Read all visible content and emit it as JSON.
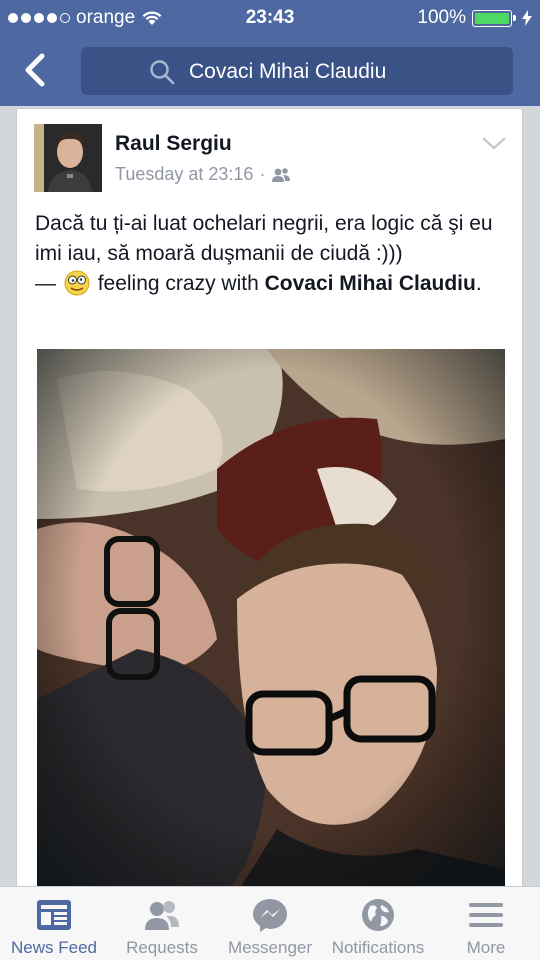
{
  "status_bar": {
    "carrier": "orange",
    "time": "23:43",
    "battery": "100%"
  },
  "header": {
    "search_text": "Covaci Mihai Claudiu"
  },
  "post": {
    "author": "Raul Sergiu",
    "timestamp": "Tuesday at 23:16",
    "separator": "·",
    "text_main": "Dacă tu ți-ai luat ochelari negrii, era logic că şi eu imi iau, să moară duşmanii de ciudă :)))",
    "text_dash": "—",
    "feeling": "feeling crazy with",
    "tagged": "Covaci Mihai Claudiu",
    "period": "."
  },
  "tabs": [
    {
      "label": "News Feed",
      "icon": "news-feed-icon"
    },
    {
      "label": "Requests",
      "icon": "requests-icon"
    },
    {
      "label": "Messenger",
      "icon": "messenger-icon"
    },
    {
      "label": "Notifications",
      "icon": "notifications-icon"
    },
    {
      "label": "More",
      "icon": "more-icon"
    }
  ],
  "colors": {
    "header": "#4e69a2",
    "active_tab": "#4e69a2",
    "inactive_tab": "#9197a3",
    "battery": "#4cd964"
  }
}
